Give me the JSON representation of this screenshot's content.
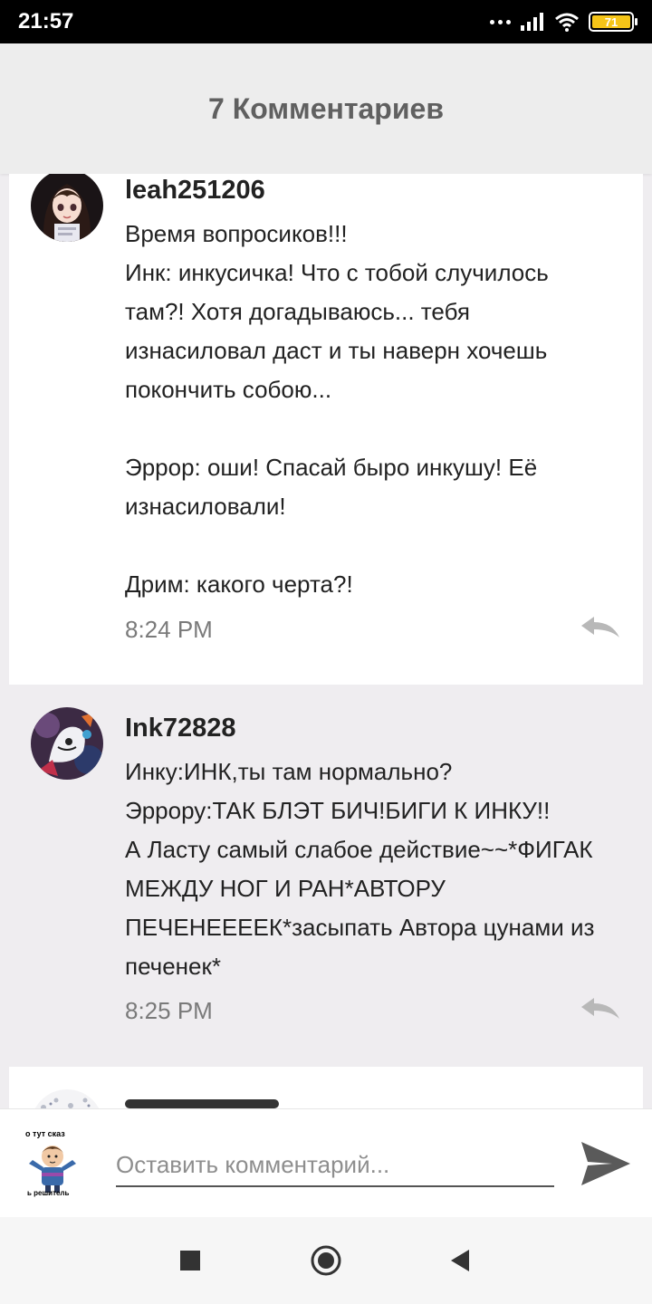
{
  "status_bar": {
    "time": "21:57",
    "battery": "71",
    "icons": [
      "dots-icon",
      "signal-icon",
      "wifi-icon",
      "battery-icon"
    ]
  },
  "header": {
    "title": "7 Комментариев"
  },
  "comments": [
    {
      "username": "leah251206",
      "text": "Время вопросиков!!!\nИнк: инкусичка! Что с тобой случилось там?! Хотя догадываюсь... тебя изнасиловал даст и ты наверн хочешь покончить собою...\n\nЭррор: оши! Спасай быро инкушу! Её изнасиловали!\n\nДрим: какого черта?!",
      "time": "8:24 PM",
      "reply_icon": "reply-icon"
    },
    {
      "username": "Ink72828",
      "text": "Инку:ИНК,ты там нормально?\nЭррору:ТАК БЛЭТ БИЧ!БИГИ К ИНКУ!!\nА Ласту самый слабое действие~~*ФИГАК МЕЖДУ НОГ И РАН*АВТОРУ ПЕЧЕНЕЕЕЕК*засыпать Автора цунами из печенек*",
      "time": "8:25 PM",
      "reply_icon": "reply-icon"
    }
  ],
  "composer": {
    "placeholder": "Оставить комментарий...",
    "avatar_caption_top": "о тут сказ",
    "avatar_caption_bottom": "ь решитель",
    "send_icon": "send-icon"
  },
  "nav_bar": {
    "icons": [
      "recents-square-icon",
      "home-circle-icon",
      "back-triangle-icon"
    ]
  },
  "colors": {
    "status_bg": "#000000",
    "header_bg": "#ededed",
    "header_text": "#606060",
    "card_white": "#ffffff",
    "card_gray": "#efedf0",
    "battery": "#f5c518"
  }
}
